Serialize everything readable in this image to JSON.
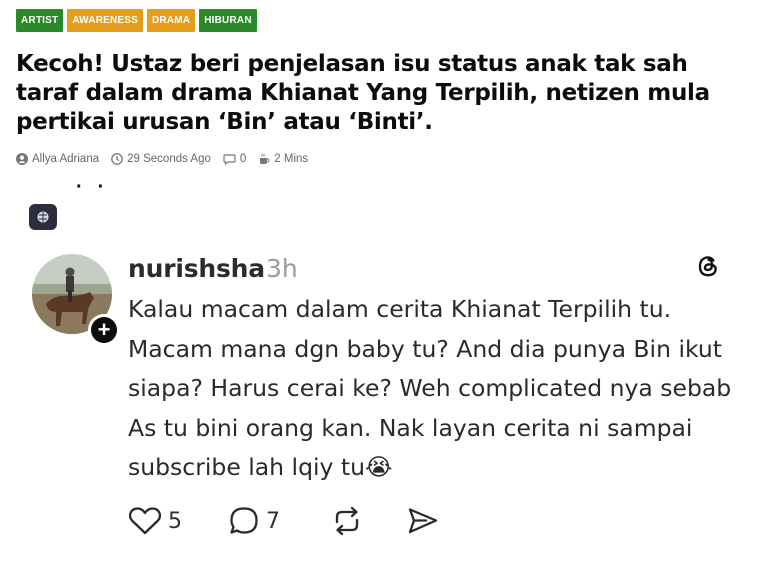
{
  "tags": [
    {
      "label": "ARTIST",
      "color": "#2a8a29"
    },
    {
      "label": "AWARENESS",
      "color": "#e69d1a"
    },
    {
      "label": "DRAMA",
      "color": "#e69d1a"
    },
    {
      "label": "HIBURAN",
      "color": "#2a8a29"
    }
  ],
  "headline": "Kecoh! Ustaz beri penjelasan isu status anak tak sah taraf dalam drama Khianat Yang Terpilih, netizen mula pertikai urusan ‘Bin’ atau ‘Binti’.",
  "meta": {
    "author": "Allya Adriana",
    "time": "29 Seconds Ago",
    "comments": "0",
    "read_time": "2 Mins"
  },
  "post": {
    "username": "nurishsha",
    "time": "3h",
    "text": "Kalau macam dalam cerita Khianat Terpilih tu. Macam mana dgn baby tu? And dia punya Bin ikut siapa? Harus cerai ke? Weh complicated nya sebab As tu bini orang kan. Nak layan cerita ni sampai subscribe lah lqiy tu😭",
    "likes": "5",
    "replies": "7"
  }
}
